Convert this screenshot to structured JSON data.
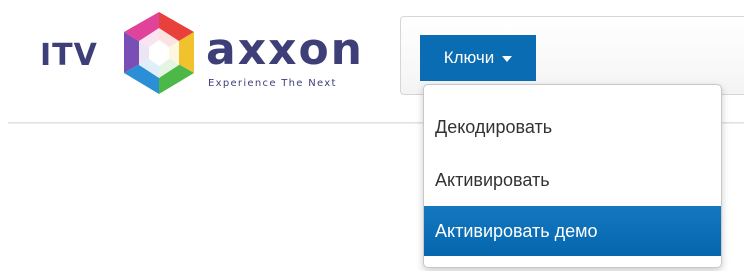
{
  "logo": {
    "prefix": "ITV",
    "wordmark": "axxon",
    "tagline": "Experience The Next"
  },
  "nav": {
    "keys_label": "Ключи",
    "keys_caret_icon": "caret-down-icon"
  },
  "dropdown": {
    "items": [
      {
        "label": "Декодировать",
        "active": false
      },
      {
        "label": "Активировать",
        "active": false
      },
      {
        "label": "Активировать демо",
        "active": true
      }
    ]
  },
  "colors": {
    "accent": "#0a6cb3",
    "logo_text": "#3e3e78",
    "menu_text": "#333333"
  }
}
